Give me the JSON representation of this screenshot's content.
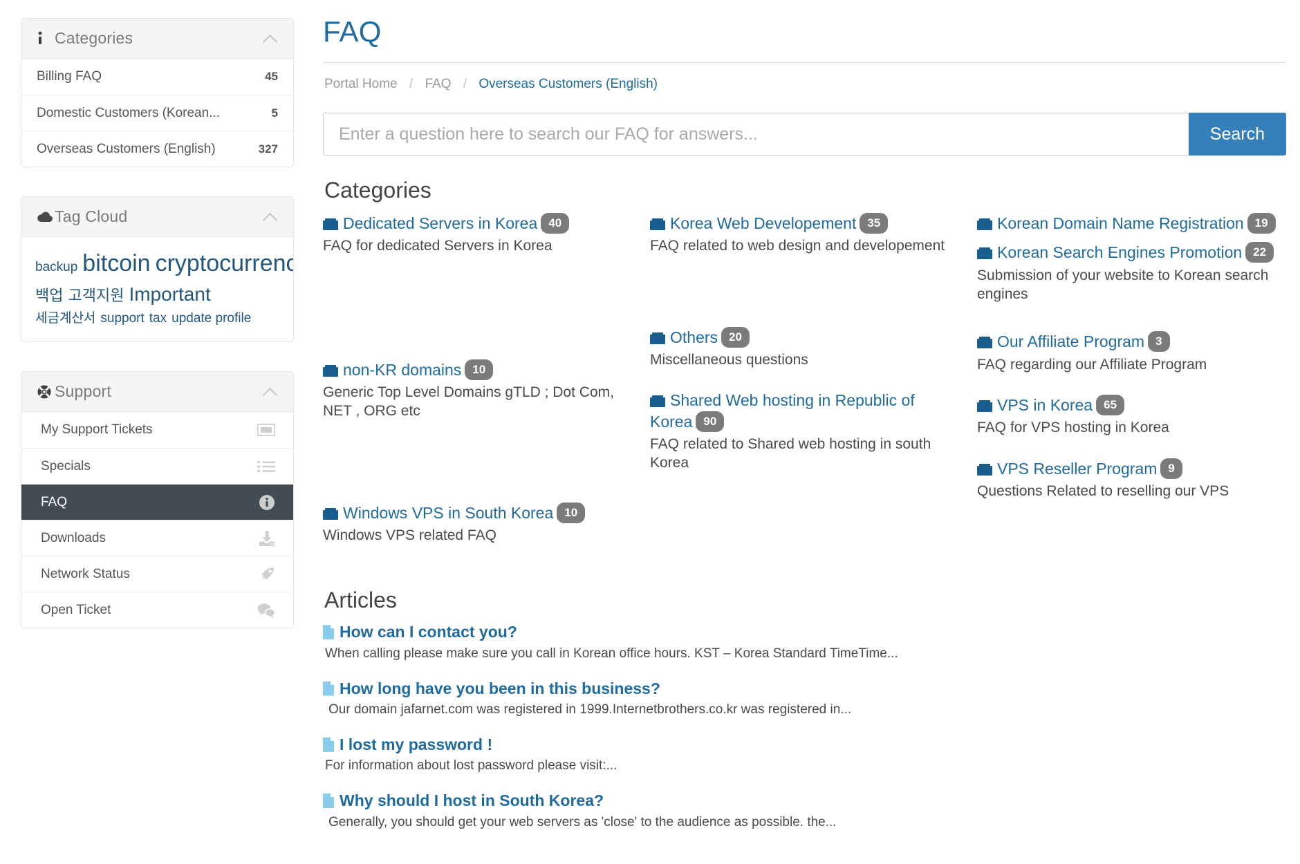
{
  "sidebar": {
    "categories_panel": {
      "icon": "info-icon",
      "title": "Categories",
      "collapse_icon": "chevron-up-icon",
      "items": [
        {
          "label": "Billing FAQ",
          "count": "45"
        },
        {
          "label": "Domestic Customers (Korean...",
          "count": "5"
        },
        {
          "label": "Overseas Customers (English)",
          "count": "327"
        }
      ]
    },
    "tag_cloud_panel": {
      "icon": "cloud-icon",
      "title": "Tag Cloud",
      "collapse_icon": "chevron-up-icon",
      "tags": [
        {
          "label": "backup",
          "size": "s-sm"
        },
        {
          "label": "bitcoin",
          "size": "s-xl"
        },
        {
          "label": "cryptocurrency",
          "size": "s-xl"
        },
        {
          "label": "백업",
          "size": "s-md"
        },
        {
          "label": "고객지원",
          "size": "s-md"
        },
        {
          "label": "Important",
          "size": "s-lg"
        },
        {
          "label": "세금계산서",
          "size": "s-sm"
        },
        {
          "label": "support",
          "size": "s-sm"
        },
        {
          "label": "tax",
          "size": "s-sm"
        },
        {
          "label": "update profile",
          "size": "s-sm"
        }
      ]
    },
    "support_panel": {
      "icon": "lifebuoy-icon",
      "title": "Support",
      "collapse_icon": "chevron-up-icon",
      "items": [
        {
          "label": "My Support Tickets",
          "icon": "ticket-icon",
          "active": false
        },
        {
          "label": "Specials",
          "icon": "list-icon",
          "active": false
        },
        {
          "label": "FAQ",
          "icon": "info-circle-icon",
          "active": true
        },
        {
          "label": "Downloads",
          "icon": "download-icon",
          "active": false
        },
        {
          "label": "Network Status",
          "icon": "rocket-icon",
          "active": false
        },
        {
          "label": "Open Ticket",
          "icon": "comments-icon",
          "active": false
        }
      ]
    }
  },
  "main": {
    "page_title": "FAQ",
    "breadcrumb": [
      {
        "label": "Portal Home",
        "current": false
      },
      {
        "label": "FAQ",
        "current": false
      },
      {
        "label": "Overseas Customers (English)",
        "current": true
      }
    ],
    "search": {
      "placeholder": "Enter a question here to search our FAQ for answers...",
      "value": "",
      "button_label": "Search"
    },
    "categories_heading": "Categories",
    "category_columns": [
      [
        {
          "title": "Dedicated Servers in Korea",
          "count": "40",
          "description": "FAQ for dedicated Servers in Korea",
          "spacer_after": 150
        },
        {
          "title": "non-KR domains",
          "count": "10",
          "description": "Generic Top Level Domains gTLD ; Dot Com, NET , ORG etc",
          "spacer_after": 120
        },
        {
          "title": "Windows VPS in South Korea",
          "count": "10",
          "description": "Windows VPS related FAQ",
          "spacer_after": 0
        }
      ],
      [
        {
          "title": "Korea Web Developement",
          "count": "35",
          "description": "FAQ related to web design and developement",
          "spacer_after": 100
        },
        {
          "title": "Others",
          "count": "20",
          "description": "Miscellaneous questions",
          "spacer_after": 0
        },
        {
          "title": "Shared Web hosting in Republic of Korea",
          "count": "90",
          "description": "FAQ related to Shared web hosting in south Korea",
          "spacer_after": 0
        }
      ],
      [
        {
          "title": "Korean Domain Name Registration",
          "count": "19",
          "description": "",
          "spacer_after": 0
        },
        {
          "title": "Korean Search Engines Promotion",
          "count": "22",
          "description": "Submission of your website to Korean search engines",
          "spacer_after": 20
        },
        {
          "title": "Our Affiliate Program",
          "count": "3",
          "description": "FAQ regarding our Affiliate Program",
          "spacer_after": 0
        },
        {
          "title": "VPS in Korea",
          "count": "65",
          "description": "FAQ for VPS hosting in Korea",
          "spacer_after": 0
        },
        {
          "title": "VPS Reseller Program",
          "count": "9",
          "description": "Questions Related to reselling our VPS",
          "spacer_after": 0
        }
      ]
    ],
    "articles_heading": "Articles",
    "articles": [
      {
        "title": "How can I contact you?",
        "snippet": "When calling please make sure you call in Korean office hours. KST – Korea Standard TimeTime..."
      },
      {
        "title": "How long have you been in this business?",
        "snippet": "Our domain  jafarnet.com was registered in 1999.Internetbrothers.co.kr was registered in..."
      },
      {
        "title": "I lost my password !",
        "snippet": "For information about lost password please visit:..."
      },
      {
        "title": "Why should I host in South Korea?",
        "snippet": "Generally, you should  get your web servers as 'close' to the audience as possible. the..."
      }
    ]
  },
  "colors": {
    "link_blue": "#1e6ba1",
    "button_blue": "#3580bb",
    "folder_blue": "#1a5d8f",
    "doc_blue": "#88cdec",
    "active_nav": "#434c55",
    "badge_gray": "#7b7b7b"
  }
}
